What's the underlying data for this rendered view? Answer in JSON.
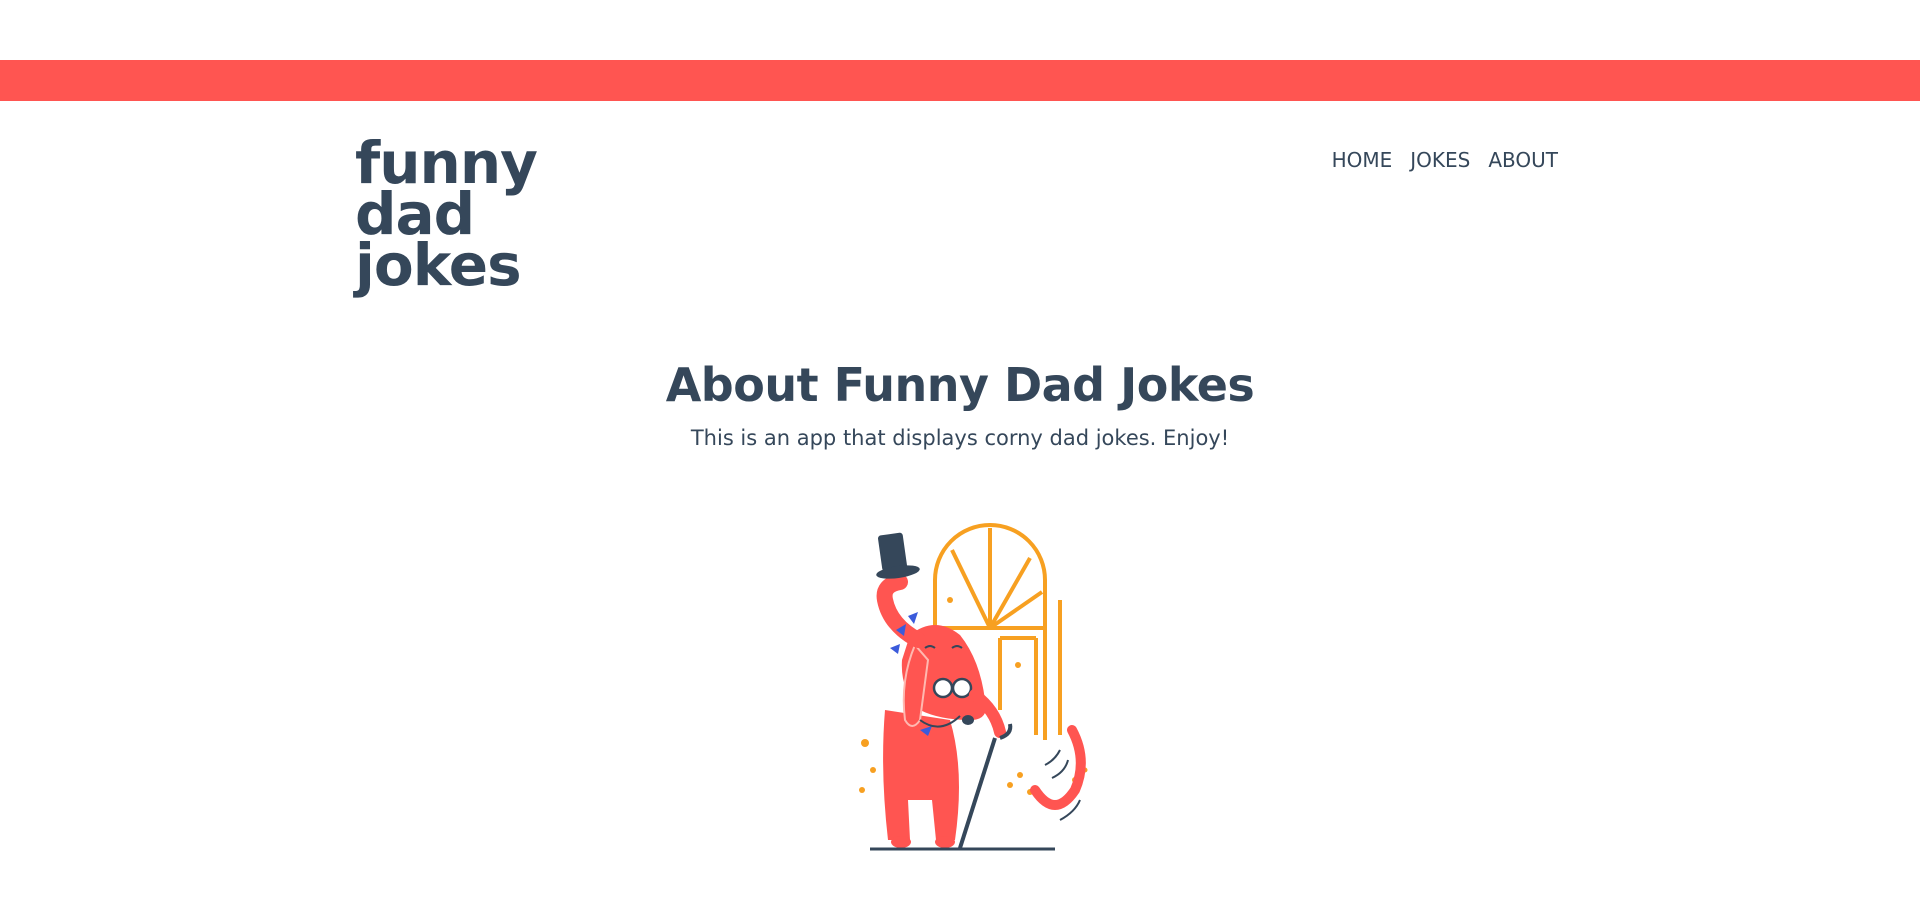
{
  "header": {
    "logo_text": "funny\ndad\njokes",
    "nav": [
      {
        "label": "HOME"
      },
      {
        "label": "JOKES"
      },
      {
        "label": "ABOUT"
      }
    ]
  },
  "main": {
    "title": "About Funny Dad Jokes",
    "description": "This is an app that displays corny dad jokes. Enjoy!",
    "illustration_icon": "bowing-dog-with-top-hat-illustration"
  },
  "colors": {
    "accent": "#ff5551",
    "text": "#35475a",
    "orange": "#f7a021",
    "background": "#ffffff"
  }
}
